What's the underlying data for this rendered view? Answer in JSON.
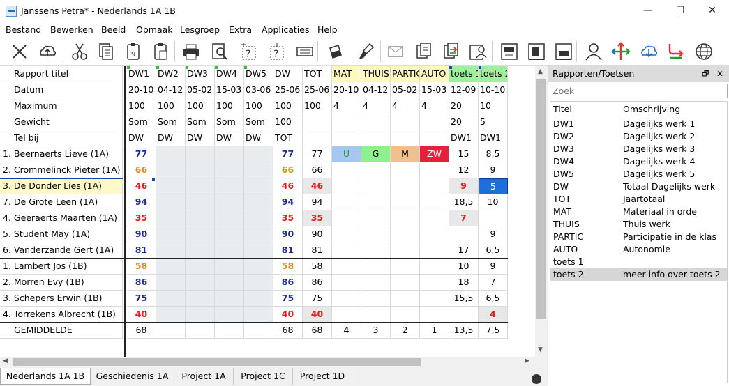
{
  "window": {
    "title": "Janssens Petra* - Nederlands 1A 1B",
    "minimize": "—",
    "maximize": "☐",
    "close": "✕"
  },
  "menu": [
    "Bestand",
    "Bewerken",
    "Beeld",
    "Opmaak",
    "Lesgroep",
    "Extra",
    "Applicaties",
    "Help"
  ],
  "toolbar_icons": [
    "close-icon",
    "cloud-upload-icon",
    "cut-icon",
    "copy-icon",
    "paste-number-icon",
    "paste-icon",
    "print-icon",
    "print-preview-icon",
    "insert-question-icon",
    "insert-question-cursor-icon",
    "text-field-icon",
    "fill-bucket-icon",
    "brush-icon",
    "mail-icon",
    "documents-icon",
    "documents-arrow-icon",
    "student-card-icon",
    "layout-top-icon",
    "layout-side-icon",
    "layout-bottom-icon",
    "user-icon",
    "arrows-icon",
    "cloud-download-icon",
    "route-icon",
    "globe-icon"
  ],
  "grid": {
    "header_labels": [
      "Rapport titel",
      "Datum",
      "Maximum",
      "Gewicht",
      "Tel bij"
    ],
    "columns": [
      {
        "title": "DW1",
        "date": "20-10",
        "max": "100",
        "weight": "Som",
        "counts": "DW",
        "bg": "#ffffff"
      },
      {
        "title": "DW2",
        "date": "04-12",
        "max": "100",
        "weight": "Som",
        "counts": "DW",
        "bg": "#ffffff"
      },
      {
        "title": "DW3",
        "date": "05-02",
        "max": "100",
        "weight": "Som",
        "counts": "DW",
        "bg": "#ffffff"
      },
      {
        "title": "DW4",
        "date": "15-03",
        "max": "100",
        "weight": "Som",
        "counts": "DW",
        "bg": "#ffffff"
      },
      {
        "title": "DW5",
        "date": "03-06",
        "max": "100",
        "weight": "Som",
        "counts": "DW",
        "bg": "#ffffff"
      },
      {
        "title": "DW",
        "date": "25-06",
        "max": "100",
        "weight": "100",
        "counts": "TOT",
        "bg": "#ffffff"
      },
      {
        "title": "TOT",
        "date": "25-06",
        "max": "100",
        "weight": "",
        "counts": "",
        "bg": "#ffffff"
      },
      {
        "title": "MAT",
        "date": "20-10",
        "max": "4",
        "weight": "",
        "counts": "",
        "bg": "#fff8c0"
      },
      {
        "title": "THUIS",
        "date": "04-12",
        "max": "4",
        "weight": "",
        "counts": "",
        "bg": "#fff8c0"
      },
      {
        "title": "PARTIC",
        "date": "05-02",
        "max": "4",
        "weight": "",
        "counts": "",
        "bg": "#fff8c0"
      },
      {
        "title": "AUTO",
        "date": "15-03",
        "max": "4",
        "weight": "",
        "counts": "",
        "bg": "#fff8c0"
      },
      {
        "title": "toets 1",
        "date": "12-09",
        "max": "20",
        "weight": "20",
        "counts": "DW1",
        "bg": "#9ef09e"
      },
      {
        "title": "toets 2",
        "date": "10-10",
        "max": "10",
        "weight": "5",
        "counts": "DW1",
        "bg": "#9ef09e"
      }
    ],
    "students": [
      {
        "name": "1. Beernaerts Lieve (1A)",
        "dw1": "77",
        "dw1c": "blue",
        "dw": "77",
        "dwc": "blue",
        "tot": "77",
        "totc": "",
        "mat": "U",
        "thuis": "G",
        "partic": "M",
        "auto": "ZW",
        "t1": "15",
        "t1c": "",
        "t2": "8,5",
        "t2c": ""
      },
      {
        "name": "2. Crommelinck Pieter (1A)",
        "dw1": "66",
        "dw1c": "orange",
        "dw": "66",
        "dwc": "orange",
        "tot": "66",
        "totc": "",
        "mat": "",
        "thuis": "",
        "partic": "",
        "auto": "",
        "t1": "12",
        "t1c": "",
        "t2": "9",
        "t2c": ""
      },
      {
        "name": "3. De Donder Lies (1A)",
        "dw1": "46",
        "dw1c": "red",
        "dw": "46",
        "dwc": "red",
        "tot": "46",
        "totc": "red",
        "mat": "",
        "thuis": "",
        "partic": "",
        "auto": "",
        "t1": "9",
        "t1c": "red",
        "t2": "5",
        "t2c": "sel"
      },
      {
        "name": "7. De Grote Leen (1A)",
        "dw1": "94",
        "dw1c": "blue",
        "dw": "94",
        "dwc": "blue",
        "tot": "94",
        "totc": "",
        "mat": "",
        "thuis": "",
        "partic": "",
        "auto": "",
        "t1": "18,5",
        "t1c": "",
        "t2": "10",
        "t2c": ""
      },
      {
        "name": "4. Geeraerts Maarten (1A)",
        "dw1": "35",
        "dw1c": "red",
        "dw": "35",
        "dwc": "red",
        "tot": "35",
        "totc": "red",
        "mat": "",
        "thuis": "",
        "partic": "",
        "auto": "",
        "t1": "7",
        "t1c": "red",
        "t2": "",
        "t2c": ""
      },
      {
        "name": "5. Student May (1A)",
        "dw1": "90",
        "dw1c": "blue",
        "dw": "90",
        "dwc": "blue",
        "tot": "90",
        "totc": "",
        "mat": "",
        "thuis": "",
        "partic": "",
        "auto": "",
        "t1": "",
        "t1c": "",
        "t2": "9",
        "t2c": ""
      },
      {
        "name": "6. Vanderzande Gert (1A)",
        "dw1": "81",
        "dw1c": "blue",
        "dw": "81",
        "dwc": "blue",
        "tot": "81",
        "totc": "",
        "mat": "",
        "thuis": "",
        "partic": "",
        "auto": "",
        "t1": "17",
        "t1c": "",
        "t2": "6,5",
        "t2c": ""
      },
      {
        "name": "1. Lambert Jos (1B)",
        "dw1": "58",
        "dw1c": "orange",
        "dw": "58",
        "dwc": "orange",
        "tot": "58",
        "totc": "",
        "mat": "",
        "thuis": "",
        "partic": "",
        "auto": "",
        "t1": "10",
        "t1c": "",
        "t2": "9",
        "t2c": ""
      },
      {
        "name": "2. Morren Evy (1B)",
        "dw1": "86",
        "dw1c": "blue",
        "dw": "86",
        "dwc": "blue",
        "tot": "86",
        "totc": "",
        "mat": "",
        "thuis": "",
        "partic": "",
        "auto": "",
        "t1": "18",
        "t1c": "",
        "t2": "7",
        "t2c": ""
      },
      {
        "name": "3. Schepers Erwin (1B)",
        "dw1": "75",
        "dw1c": "blue",
        "dw": "75",
        "dwc": "blue",
        "tot": "75",
        "totc": "",
        "mat": "",
        "thuis": "",
        "partic": "",
        "auto": "",
        "t1": "15,5",
        "t1c": "",
        "t2": "6,5",
        "t2c": ""
      },
      {
        "name": "4. Torrekens Albrecht (1B)",
        "dw1": "40",
        "dw1c": "red",
        "dw": "40",
        "dwc": "red",
        "tot": "40",
        "totc": "red",
        "mat": "",
        "thuis": "",
        "partic": "",
        "auto": "",
        "t1": "",
        "t1c": "",
        "t2": "4",
        "t2c": "red"
      }
    ],
    "average": {
      "label": "GEMIDDELDE",
      "dw1": "68",
      "dw": "68",
      "tot": "68",
      "mat": "4",
      "thuis": "3",
      "partic": "2",
      "auto": "1",
      "t1": "13,5",
      "t2": "7,5"
    },
    "selected_student_index": 2,
    "evaluation_colors": {
      "U": "#a6c8f0",
      "G": "#8ef08e",
      "M": "#f0c090",
      "ZW": "#e8203c"
    }
  },
  "tabs": [
    "Nederlands 1A 1B",
    "Geschiedenis 1A",
    "Project 1A",
    "Project 1C",
    "Project 1D"
  ],
  "panel": {
    "title": "Rapporten/Toetsen",
    "pin": "🗗",
    "close": "✕",
    "search_placeholder": "Zoek",
    "col_title": "Titel",
    "col_desc": "Omschrijving",
    "items": [
      {
        "t": "DW1",
        "d": "Dagelijks werk 1"
      },
      {
        "t": "DW2",
        "d": "Dagelijks werk 2"
      },
      {
        "t": "DW3",
        "d": "Dagelijks werk 3"
      },
      {
        "t": "DW4",
        "d": "Dagelijks werk 4"
      },
      {
        "t": "DW5",
        "d": "Dagelijks werk 5"
      },
      {
        "t": "DW",
        "d": "Totaal Dagelijks werk"
      },
      {
        "t": "TOT",
        "d": "Jaartotaal"
      },
      {
        "t": "MAT",
        "d": "Materiaal in orde"
      },
      {
        "t": "THUIS",
        "d": "Thuis werk"
      },
      {
        "t": "PARTIC",
        "d": "Participatie in de klas"
      },
      {
        "t": "AUTO",
        "d": "Autonomie"
      },
      {
        "t": "toets 1",
        "d": ""
      },
      {
        "t": "toets 2",
        "d": "meer info over toets 2"
      }
    ],
    "selected_index": 12
  }
}
